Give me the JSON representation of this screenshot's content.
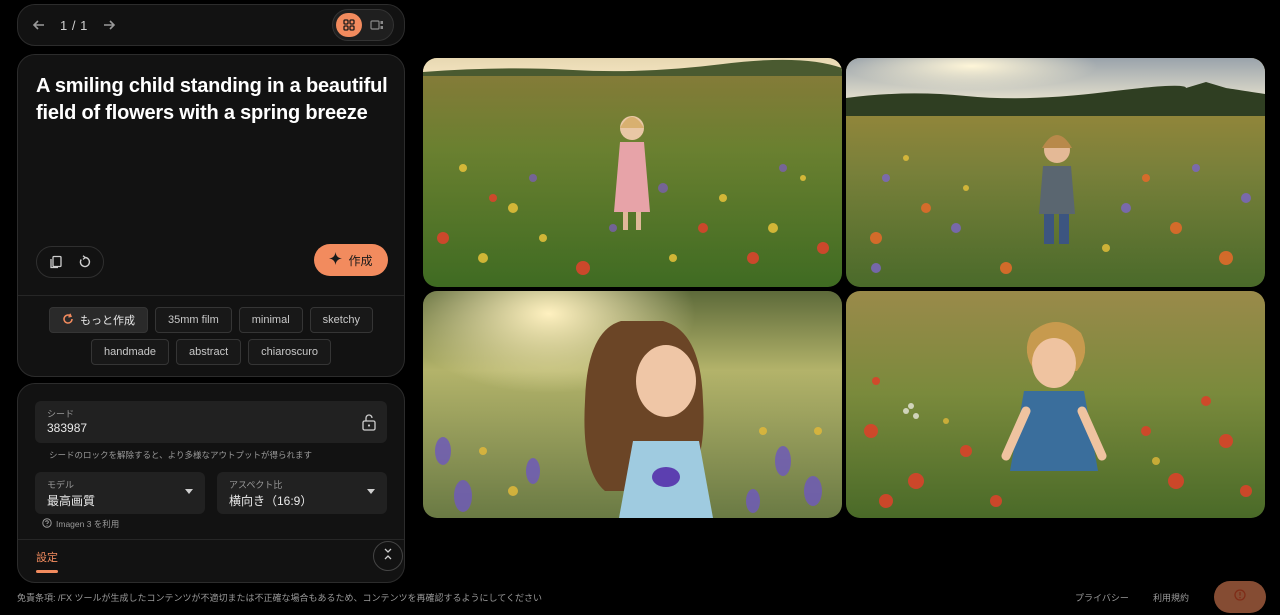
{
  "nav": {
    "pager": "1 / 1",
    "prev_icon": "arrow-left-icon",
    "next_icon": "arrow-right-icon"
  },
  "prompt": {
    "text": "A smiling child standing in a beautiful field of flowers with a spring breeze",
    "create_label": "作成"
  },
  "chips_row1": [
    "もっと作成",
    "35mm film",
    "minimal",
    "sketchy"
  ],
  "chips_row2": [
    "handmade",
    "abstract",
    "chiaroscuro"
  ],
  "settings": {
    "seed_label": "シード",
    "seed_value": "383987",
    "seed_hint": "シードのロックを解除すると、より多様なアウトプットが得られます",
    "model_label": "モデル",
    "model_value": "最高画質",
    "aspect_label": "アスペクト比",
    "aspect_value": "横向き（16:9）",
    "imagen_note": "Imagen 3 を利用",
    "tab_label": "設定"
  },
  "images": [
    {
      "description": "girl-pink-dress-flower-field"
    },
    {
      "description": "boy-grey-shirt-flower-field"
    },
    {
      "description": "girl-curly-hair-lavender-field"
    },
    {
      "description": "boy-blue-shirt-poppy-field"
    }
  ],
  "footer": {
    "disclaimer": "免責条項: /FX ツールが生成したコンテンツが不適切または不正確な場合もあるため、コンテンツを再確認するようにしてください",
    "privacy": "プライバシー",
    "terms": "利用規約"
  },
  "colors": {
    "accent": "#f28b5e",
    "panel": "#121212",
    "background": "#000000"
  }
}
